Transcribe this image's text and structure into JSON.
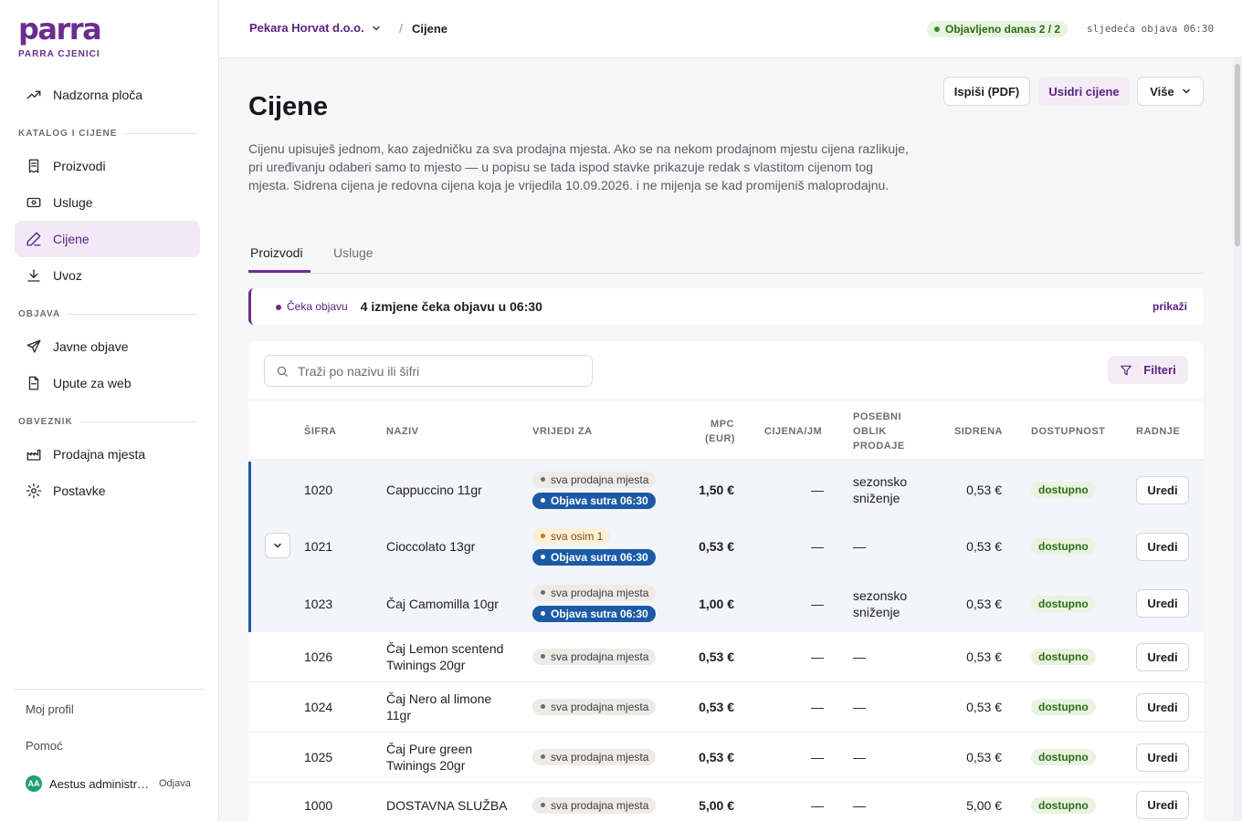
{
  "brand": {
    "logo": "parra",
    "subtitle": "PARRA CJENICI"
  },
  "sidebar": {
    "top": [
      {
        "label": "Nadzorna ploča",
        "icon": "trending-up-icon"
      }
    ],
    "sections": [
      {
        "title": "KATALOG I CIJENE",
        "items": [
          {
            "label": "Proizvodi",
            "icon": "receipt-icon"
          },
          {
            "label": "Usluge",
            "icon": "banknote-icon"
          },
          {
            "label": "Cijene",
            "icon": "pencil-icon",
            "active": true
          },
          {
            "label": "Uvoz",
            "icon": "download-icon"
          }
        ]
      },
      {
        "title": "OBJAVA",
        "items": [
          {
            "label": "Javne objave",
            "icon": "send-icon"
          },
          {
            "label": "Upute za web",
            "icon": "file-icon"
          }
        ]
      },
      {
        "title": "OBVEZNIK",
        "items": [
          {
            "label": "Prodajna mjesta",
            "icon": "factory-icon"
          },
          {
            "label": "Postavke",
            "icon": "gear-icon"
          }
        ]
      }
    ],
    "profile": "Moj profil",
    "help": "Pomoć",
    "user": {
      "initials": "AA",
      "name": "Aestus administr…",
      "logout": "Odjava"
    }
  },
  "topbar": {
    "org": "Pekara Horvat d.o.o.",
    "separator": "/",
    "crumb": "Cijene",
    "published": "Objavljeno danas 2 / 2",
    "next": "sljedeća objava 06:30"
  },
  "header": {
    "title": "Cijene",
    "description": "Cijenu upisuješ jednom, kao zajedničku za sva prodajna mjesta. Ako se na nekom prodajnom mjestu cijena razlikuje, pri uređivanju odaberi samo to mjesto — u popisu se tada ispod stavke prikazuje redak s vlastitom cijenom tog mjesta. Sidrena cijena je redovna cijena koja je vrijedila 10.09.2026. i ne mijenja se kad promijeniš maloprodajnu.",
    "print_label": "Ispiši (PDF)",
    "anchor_label": "Usidri cijene",
    "more_label": "Više"
  },
  "tabs": [
    {
      "label": "Proizvodi",
      "active": true
    },
    {
      "label": "Usluge"
    }
  ],
  "pending": {
    "pill": "Čeka objavu",
    "text": "4 izmjene čeka objavu u 06:30",
    "link": "prikaži"
  },
  "table": {
    "search_placeholder": "Traži po nazivu ili šifri",
    "filters_label": "Filteri",
    "columns": {
      "code": "ŠIFRA",
      "name": "NAZIV",
      "valid": "VRIJEDI ZA",
      "mpc_1": "MPC",
      "mpc_2": "(EUR)",
      "per_unit": "CIJENA/JM",
      "special_1": "POSEBNI",
      "special_2": "OBLIK",
      "special_3": "PRODAJE",
      "anchor": "SIDRENA",
      "availability": "DOSTUPNOST",
      "actions": "RADNJE"
    },
    "rows": [
      {
        "code": "1020",
        "name": "Cappuccino 11gr",
        "scope": "sva prodajna mjesta",
        "scope_type": "all",
        "pending": "Objava sutra 06:30",
        "mpc": "1,50 €",
        "per_unit": "—",
        "special": "sezonsko sniženje",
        "anchor": "0,53 €",
        "availability": "dostupno",
        "action": "Uredi"
      },
      {
        "code": "1021",
        "name": "Cioccolato 13gr",
        "scope": "sva osim 1",
        "scope_type": "except",
        "pending": "Objava sutra 06:30",
        "mpc": "0,53 €",
        "per_unit": "—",
        "special": "—",
        "anchor": "0,53 €",
        "availability": "dostupno",
        "action": "Uredi",
        "expandable": true
      },
      {
        "code": "1023",
        "name": "Čaj Camomilla 10gr",
        "scope": "sva prodajna mjesta",
        "scope_type": "all",
        "pending": "Objava sutra 06:30",
        "mpc": "1,00 €",
        "per_unit": "—",
        "special": "sezonsko sniženje",
        "anchor": "0,53 €",
        "availability": "dostupno",
        "action": "Uredi"
      },
      {
        "code": "1026",
        "name": "Čaj Lemon scentend Twinings 20gr",
        "scope": "sva prodajna mjesta",
        "scope_type": "all",
        "mpc": "0,53 €",
        "per_unit": "—",
        "special": "—",
        "anchor": "0,53 €",
        "availability": "dostupno",
        "action": "Uredi"
      },
      {
        "code": "1024",
        "name": "Čaj Nero al limone 11gr",
        "scope": "sva prodajna mjesta",
        "scope_type": "all",
        "mpc": "0,53 €",
        "per_unit": "—",
        "special": "—",
        "anchor": "0,53 €",
        "availability": "dostupno",
        "action": "Uredi"
      },
      {
        "code": "1025",
        "name": "Čaj Pure green Twinings 20gr",
        "scope": "sva prodajna mjesta",
        "scope_type": "all",
        "mpc": "0,53 €",
        "per_unit": "—",
        "special": "—",
        "anchor": "0,53 €",
        "availability": "dostupno",
        "action": "Uredi"
      },
      {
        "code": "1000",
        "name": "DOSTAVNA SLUŽBA",
        "scope": "sva prodajna mjesta",
        "scope_type": "all",
        "mpc": "5,00 €",
        "per_unit": "—",
        "special": "—",
        "anchor": "5,00 €",
        "availability": "dostupno",
        "action": "Uredi"
      }
    ]
  },
  "colors": {
    "brand": "#6b2d8f",
    "publish_blue": "#1c5aa6",
    "available_green": "#2e6c1a"
  }
}
